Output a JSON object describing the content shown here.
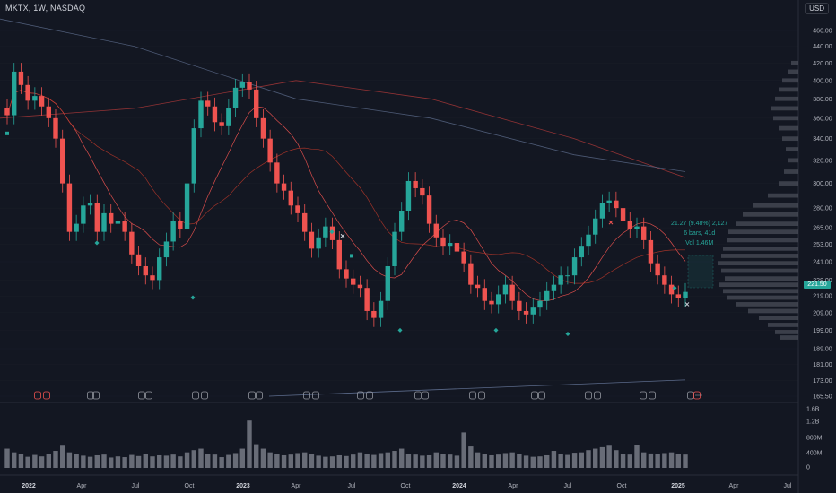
{
  "header": {
    "symbol_line": "MKTX, 1W, NASDAQ",
    "currency": "USD"
  },
  "measure": {
    "line1": "21.27 (9.48%) 2,127",
    "line2": "6 bars, 41d",
    "line3": "Vol 1.46M"
  },
  "colors": {
    "bg": "#131722",
    "up": "#26a69a",
    "down": "#ef5350",
    "grid": "#2a2e39",
    "text": "#b2b5be",
    "ma_red": "#ef5350",
    "ma_blue": "#5b6a8a"
  },
  "chart_data": {
    "type": "candlestick",
    "interval": "1W",
    "price_axis": {
      "ticks": [
        460,
        440,
        420,
        400,
        380,
        360,
        340,
        320,
        300,
        280,
        265,
        253,
        241,
        229,
        219,
        209,
        199,
        189,
        181,
        173,
        165.5
      ],
      "labels": [
        "460.00",
        "440.00",
        "420.00",
        "400.00",
        "380.00",
        "360.00",
        "340.00",
        "320.00",
        "300.00",
        "280.00",
        "265.00",
        "253.00",
        "241.00",
        "229.00",
        "219.00",
        "209.00",
        "199.00",
        "189.00",
        "181.00",
        "173.00",
        "165.50"
      ],
      "scale": "log"
    },
    "time_axis": {
      "labels": [
        "2022",
        "Apr",
        "Jul",
        "Oct",
        "2023",
        "Apr",
        "Jul",
        "Oct",
        "2024",
        "Apr",
        "Jul",
        "Oct",
        "2025",
        "Apr",
        "Jul"
      ]
    },
    "volume_axis": {
      "labels": [
        "1.6B",
        "1.2B",
        "800M",
        "400M",
        "0"
      ]
    },
    "last_price": 221.5,
    "weekly_close": [
      363,
      410,
      395,
      378,
      383,
      372,
      360,
      340,
      300,
      262,
      268,
      282,
      284,
      262,
      276,
      268,
      270,
      262,
      246,
      238,
      232,
      229,
      244,
      255,
      270,
      264,
      300,
      350,
      378,
      372,
      356,
      352,
      370,
      392,
      398,
      390,
      360,
      340,
      318,
      300,
      294,
      282,
      276,
      262,
      250,
      258,
      266,
      256,
      236,
      230,
      226,
      224,
      210,
      206,
      216,
      238,
      262,
      278,
      302,
      296,
      290,
      268,
      258,
      252,
      254,
      248,
      240,
      226,
      224,
      216,
      214,
      220,
      226,
      216,
      210,
      208,
      212,
      216,
      222,
      226,
      232,
      232,
      244,
      252,
      260,
      272,
      284,
      286,
      280,
      270,
      264,
      266,
      256,
      240,
      232,
      226,
      220,
      218,
      221.5
    ],
    "volume": [
      520,
      420,
      380,
      300,
      350,
      310,
      380,
      460,
      600,
      420,
      380,
      330,
      300,
      340,
      360,
      280,
      310,
      290,
      350,
      320,
      380,
      310,
      340,
      330,
      360,
      310,
      420,
      480,
      520,
      380,
      360,
      290,
      350,
      400,
      520,
      1280,
      640,
      520,
      420,
      380,
      340,
      360,
      400,
      420,
      380,
      330,
      300,
      310,
      340,
      320,
      360,
      420,
      380,
      350,
      400,
      420,
      460,
      520,
      380,
      360,
      330,
      340,
      420,
      380,
      360,
      330,
      960,
      580,
      420,
      380,
      340,
      360,
      400,
      420,
      380,
      330,
      300,
      310,
      340,
      460,
      380,
      350,
      410,
      420,
      480,
      520,
      560,
      600,
      480,
      380,
      360,
      620,
      420,
      390,
      380,
      400,
      420,
      380,
      360
    ]
  }
}
